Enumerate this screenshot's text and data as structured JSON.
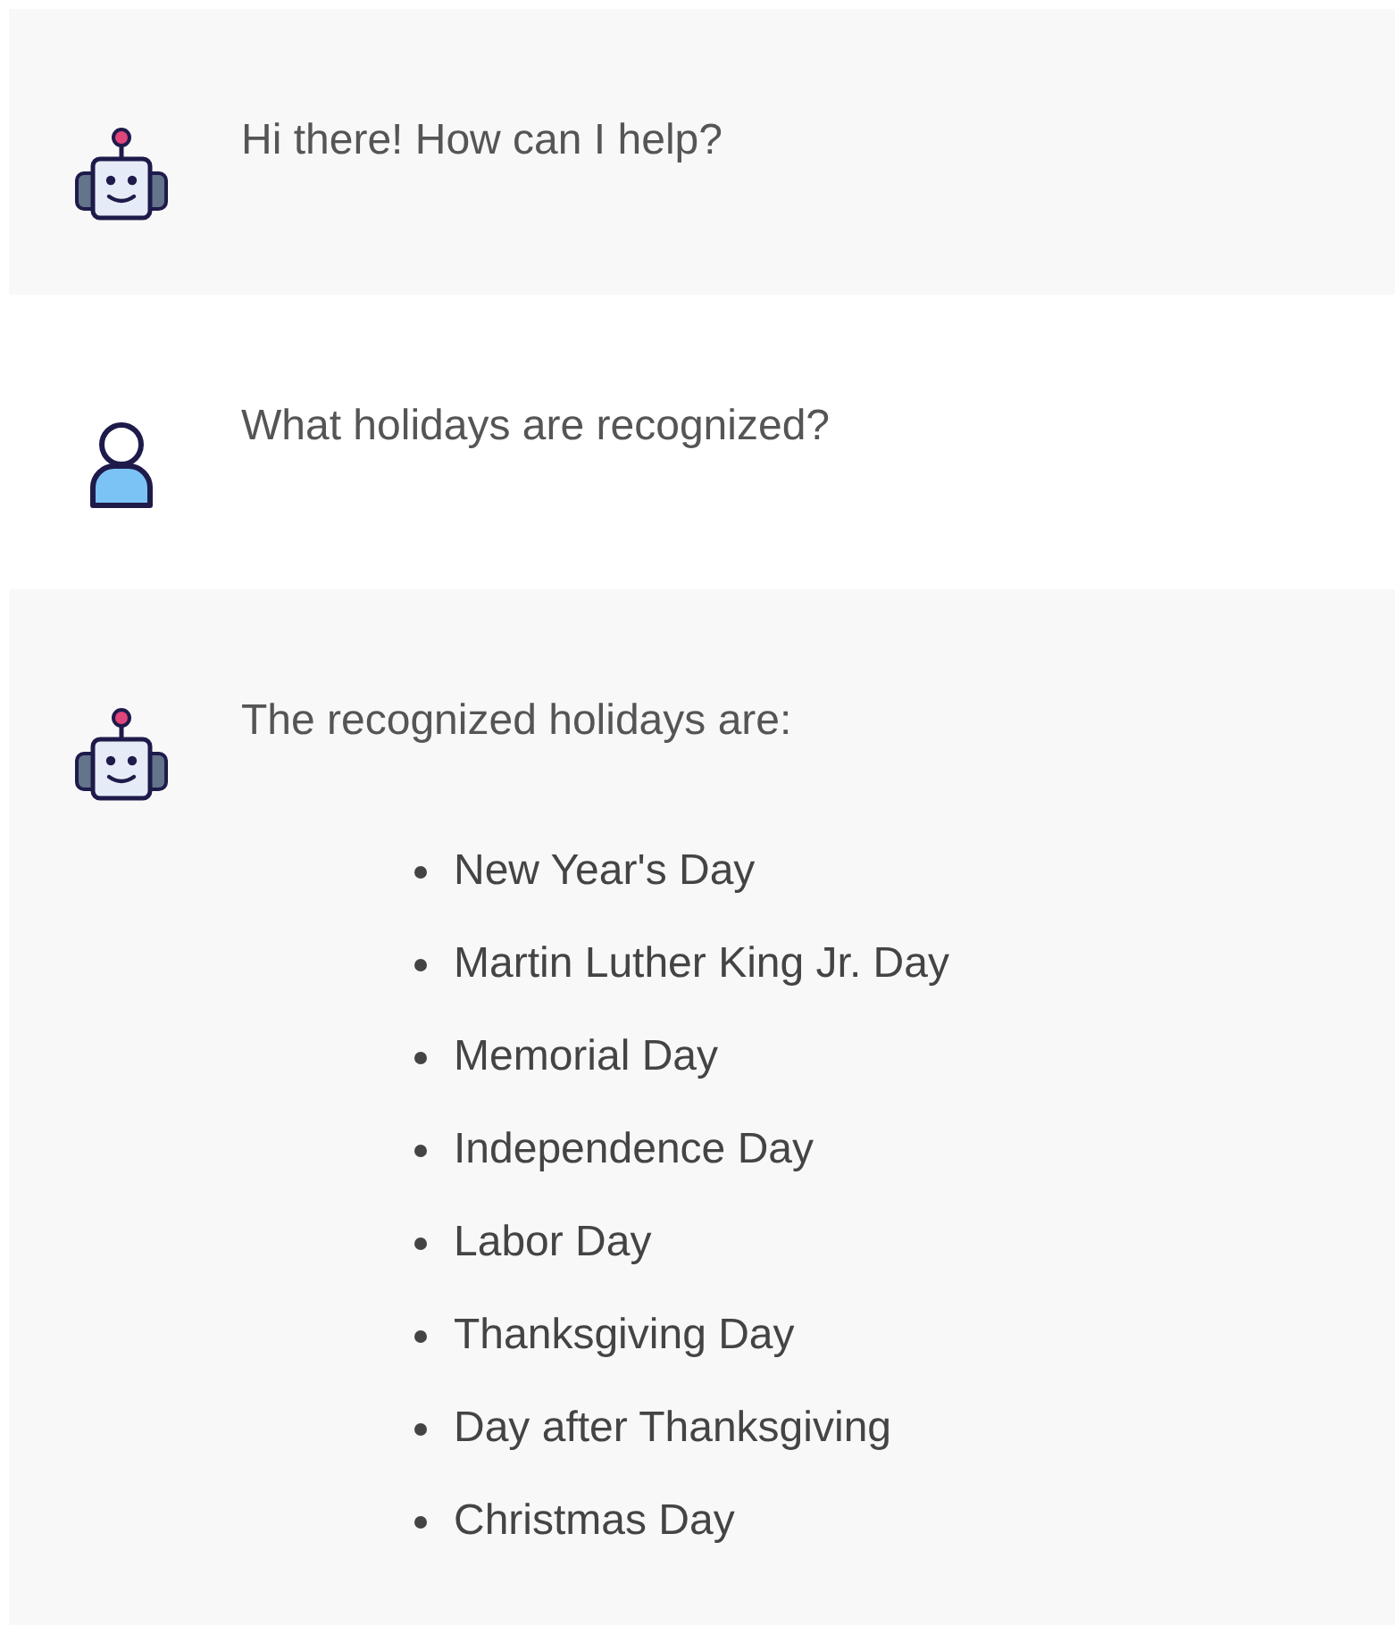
{
  "messages": [
    {
      "kind": "bot",
      "text": "Hi there! How can I help?"
    },
    {
      "kind": "user",
      "text": "What holidays are recognized?"
    },
    {
      "kind": "bot",
      "text": "The recognized holidays are:",
      "list": [
        "New Year's Day",
        "Martin Luther King Jr. Day",
        "Memorial Day",
        "Independence Day",
        "Labor Day",
        "Thanksgiving Day",
        "Day after Thanksgiving",
        "Christmas Day"
      ]
    }
  ]
}
